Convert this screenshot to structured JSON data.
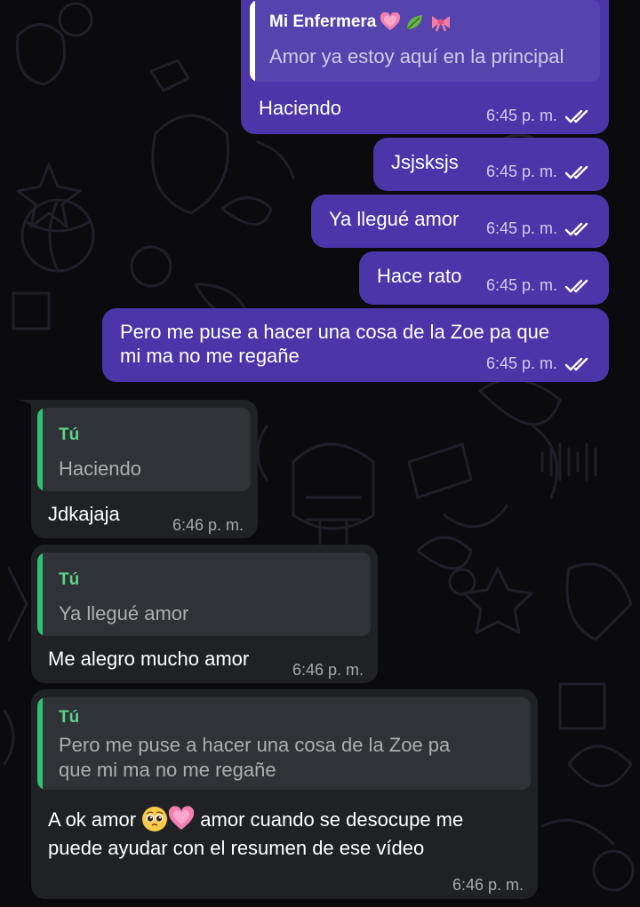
{
  "colors": {
    "outgoing_bubble": "#4a36a8",
    "incoming_bubble": "#1f2124",
    "quote_bar_outgoing": "#ffffff",
    "quote_bar_incoming": "#2fbf71",
    "quote_name_incoming": "#5fd38a"
  },
  "messages": [
    {
      "direction": "outgoing",
      "reply": {
        "name": "Mi Enfermera",
        "name_emojis": [
          "pink-heart",
          "leaf",
          "ribbon"
        ],
        "text": "Amor ya estoy aquí en la principal"
      },
      "text": "Haciendo",
      "time": "6:45 p. m.",
      "status": "read-double-check"
    },
    {
      "direction": "outgoing",
      "text": "Jsjsksjs",
      "time": "6:45 p. m.",
      "status": "read-double-check"
    },
    {
      "direction": "outgoing",
      "text": "Ya llegué amor",
      "time": "6:45 p. m.",
      "status": "read-double-check"
    },
    {
      "direction": "outgoing",
      "text": "Hace rato",
      "time": "6:45 p. m.",
      "status": "read-double-check"
    },
    {
      "direction": "outgoing",
      "text_lines": [
        "Pero me puse a hacer una cosa de la Zoe pa que",
        "mi ma no me regañe"
      ],
      "time": "6:45 p. m.",
      "status": "read-double-check"
    },
    {
      "direction": "incoming",
      "reply": {
        "name": "Tú",
        "text": "Haciendo"
      },
      "text": "Jdkajaja",
      "time": "6:46 p. m."
    },
    {
      "direction": "incoming",
      "reply": {
        "name": "Tú",
        "text": "Ya llegué amor"
      },
      "text": "Me alegro mucho amor",
      "time": "6:46 p. m."
    },
    {
      "direction": "incoming",
      "reply": {
        "name": "Tú",
        "text_lines": [
          "Pero me puse a hacer una cosa de la Zoe pa",
          "que mi ma no me regañe"
        ]
      },
      "text_parts": {
        "before": "A ok amor ",
        "emojis": [
          "pleading-face",
          "pink-heart"
        ],
        "after": "amor cuando se desocupe me"
      },
      "text_line2": "puede ayudar con el resumen de ese vídeo",
      "time": "6:46 p. m."
    }
  ]
}
